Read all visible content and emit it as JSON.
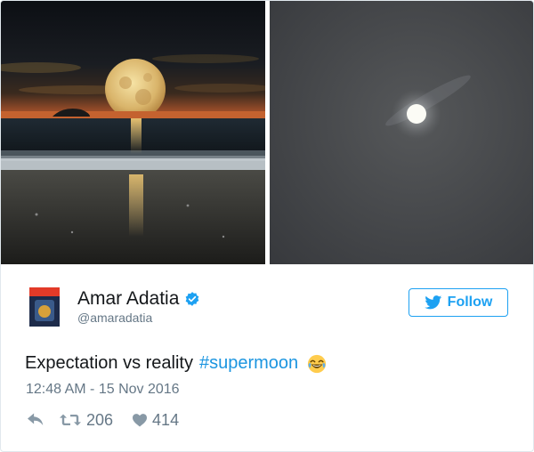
{
  "tweet": {
    "author_name": "Amar Adatia",
    "author_handle": "@amaradatia",
    "follow_label": "Follow",
    "text": "Expectation vs reality",
    "hashtag": "#supermoon",
    "timestamp": "12:48 AM - 15 Nov 2016",
    "retweet_count": "206",
    "like_count": "414"
  },
  "images": {
    "left": "expectation-moon-over-sea",
    "right": "reality-small-moon-grey-sky"
  },
  "icons": [
    "verified-badge-icon",
    "twitter-bird-icon",
    "laughing-emoji-icon",
    "reply-icon",
    "retweet-icon",
    "heart-icon"
  ],
  "colors": {
    "link": "#1b95e0",
    "follow": "#1da1f2",
    "muted": "#657786"
  }
}
